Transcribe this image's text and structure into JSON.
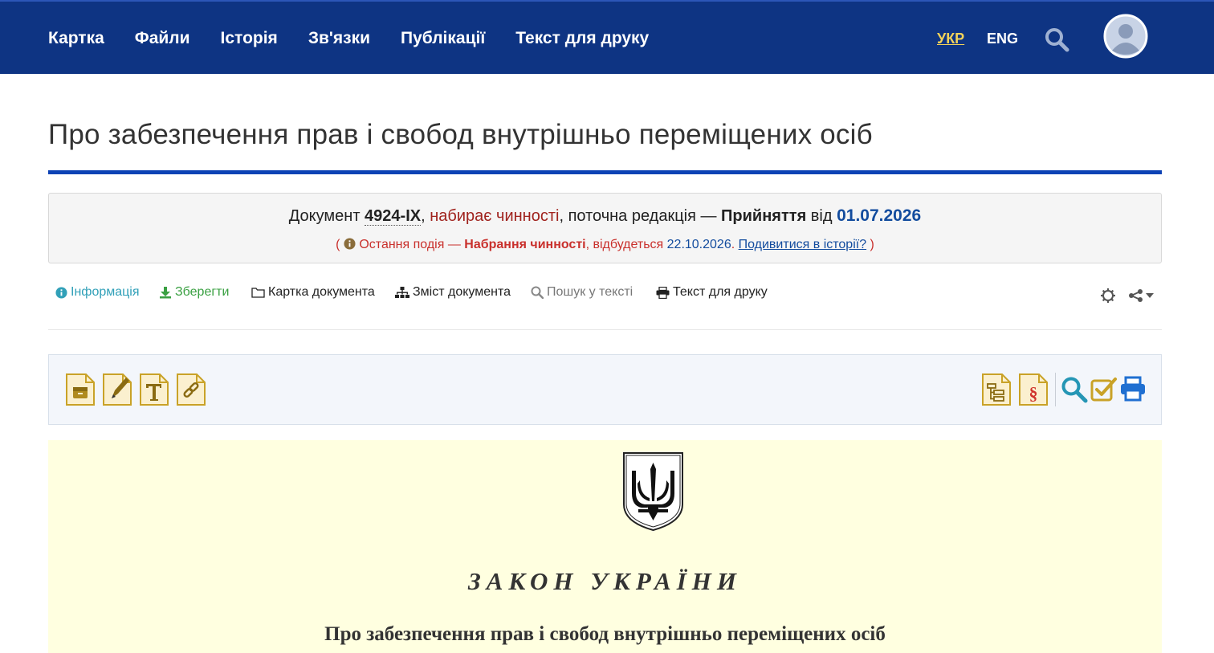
{
  "nav": {
    "items": [
      "Картка",
      "Файли",
      "Історія",
      "Зв'язки",
      "Публікації",
      "Текст для друку"
    ],
    "lang_ukr": "УКР",
    "lang_eng": "ENG"
  },
  "page": {
    "title": "Про забезпечення прав і свобод внутрішньо переміщених осіб"
  },
  "status": {
    "doc_prefix": "Документ ",
    "doc_number": "4924-IX",
    "comma1": ", ",
    "state": "набирає чинності",
    "edition_text": ", поточна редакція — ",
    "edition_type": "Прийняття",
    "from_text": " від ",
    "edition_date": "01.07.2026",
    "paren_open": "( ",
    "event_prefix": " Остання подія — ",
    "event_name": "Набрання чинності",
    "event_mid": ", відбудеться ",
    "event_date": "22.10.2026",
    "dot": ". ",
    "history_link": "Подивитися в історії?",
    "paren_close": " )"
  },
  "tabs": {
    "info": "Інформація",
    "save": "Зберегти",
    "card": "Картка документа",
    "contents": "Зміст документа",
    "search": "Пошук у тексті",
    "print": "Текст для друку"
  },
  "document": {
    "law_title": "ЗАКОН УКРАЇНИ",
    "law_subtitle": "Про забезпечення прав і свобод внутрішньо переміщених осіб"
  },
  "colors": {
    "header_bg": "#0e3483",
    "accent_rule": "#0c42b5",
    "link_blue": "#134c9e",
    "status_red": "#c9302c",
    "info_teal": "#31a0b8",
    "save_green": "#3aa042",
    "doc_bg": "#ffffe0",
    "icon_gold": "#c9a227"
  },
  "icons": [
    "search-icon",
    "user-avatar-icon",
    "info-icon",
    "download-icon",
    "folder-icon",
    "sitemap-icon",
    "print-icon",
    "gear-icon",
    "share-icon",
    "caret-down-icon",
    "archive-doc-icon",
    "edit-doc-icon",
    "text-doc-icon",
    "link-doc-icon",
    "structure-doc-icon",
    "section-doc-icon",
    "zoom-icon",
    "check-icon",
    "printer-icon",
    "trident-emblem"
  ]
}
